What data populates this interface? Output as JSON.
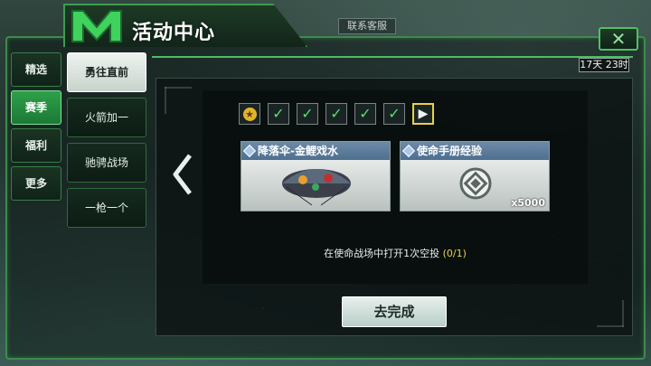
{
  "header": {
    "title": "活动中心",
    "support_label": "联系客服",
    "close_symbol": "✕"
  },
  "main_nav": {
    "items": [
      {
        "label": "精选",
        "active": false
      },
      {
        "label": "赛季",
        "active": true
      },
      {
        "label": "福利",
        "active": false
      },
      {
        "label": "更多",
        "active": false
      }
    ]
  },
  "sub_nav": {
    "items": [
      {
        "label": "勇往直前",
        "active": true
      },
      {
        "label": "火箭加一",
        "active": false
      },
      {
        "label": "驰骋战场",
        "active": false
      },
      {
        "label": "一枪一个",
        "active": false
      }
    ]
  },
  "timer": "17天 23时",
  "progress": {
    "steps": [
      "star",
      "check",
      "check",
      "check",
      "check",
      "check",
      "current"
    ]
  },
  "rewards": [
    {
      "name": "降落伞-金鲤戏水",
      "quantity": ""
    },
    {
      "name": "使命手册经验",
      "quantity": "x5000"
    }
  ],
  "task": {
    "text": "在使命战场中打开1次空投",
    "progress": "(0/1)"
  },
  "go_button": "去完成",
  "colors": {
    "accent_green": "#4fc065",
    "active_tab": "#2fa04a",
    "progress_yellow": "#e8d04a",
    "card_header": "#5a7a9b"
  }
}
